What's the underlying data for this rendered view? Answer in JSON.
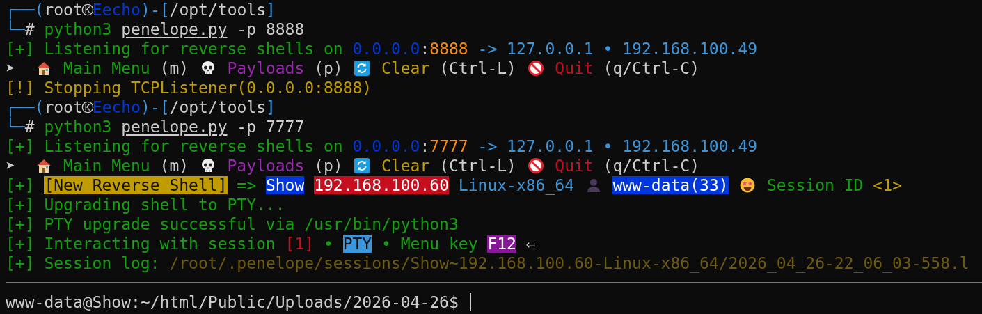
{
  "lines": [
    {
      "segments": [
        {
          "kind": "text",
          "text": "┌──(",
          "color": "#3a96dd"
        },
        {
          "kind": "text",
          "text": "root",
          "color": "#cccccc"
        },
        {
          "kind": "kali"
        },
        {
          "kind": "text",
          "text": "Eecho",
          "color": "#0037da"
        },
        {
          "kind": "text",
          "text": ")-[",
          "color": "#3a96dd"
        },
        {
          "kind": "text",
          "text": "/opt/tools",
          "color": "#cccccc"
        },
        {
          "kind": "text",
          "text": "]",
          "color": "#3a96dd"
        }
      ]
    },
    {
      "segments": [
        {
          "kind": "text",
          "text": "└─",
          "color": "#3a96dd"
        },
        {
          "kind": "text",
          "text": "# ",
          "color": "#cccccc"
        },
        {
          "kind": "text",
          "text": "python3 ",
          "color": "#13a10e"
        },
        {
          "kind": "file",
          "text": "penelope.py",
          "color": "#cccccc"
        },
        {
          "kind": "text",
          "text": " -p 8888",
          "color": "#cccccc"
        }
      ]
    },
    {
      "segments": [
        {
          "kind": "text",
          "text": "[+] Listening for reverse shells on ",
          "color": "#13a10e"
        },
        {
          "kind": "text",
          "text": "0.0.0.0",
          "color": "#0037da"
        },
        {
          "kind": "text",
          "text": ":",
          "color": "#cccccc"
        },
        {
          "kind": "text",
          "text": "8888",
          "color": "#f78c0c"
        },
        {
          "kind": "text",
          "text": " -> 127.0.0.1 • 192.168.100.49",
          "color": "#3a96dd"
        }
      ]
    },
    {
      "segments": [
        {
          "kind": "text",
          "text": "➤  ",
          "color": "#cccccc"
        },
        {
          "kind": "house"
        },
        {
          "kind": "text",
          "text": " Main Menu ",
          "color": "#13a10e"
        },
        {
          "kind": "text",
          "text": "(m) ",
          "color": "#cccccc"
        },
        {
          "kind": "skull"
        },
        {
          "kind": "text",
          "text": " Payloads ",
          "color": "#9a2aae"
        },
        {
          "kind": "text",
          "text": "(p) ",
          "color": "#cccccc"
        },
        {
          "kind": "refresh"
        },
        {
          "kind": "text",
          "text": " Clear ",
          "color": "#c19c00"
        },
        {
          "kind": "text",
          "text": "(Ctrl-L) ",
          "color": "#cccccc"
        },
        {
          "kind": "noentry"
        },
        {
          "kind": "text",
          "text": " Quit ",
          "color": "#c50f1f"
        },
        {
          "kind": "text",
          "text": "(q/Ctrl-C)",
          "color": "#cccccc"
        }
      ]
    },
    {
      "segments": [
        {
          "kind": "text",
          "text": "[!] Stopping TCPListener(0.0.0.0:8888)",
          "color": "#c19c00"
        }
      ]
    },
    {
      "segments": [
        {
          "kind": "text",
          "text": "┌──(",
          "color": "#3a96dd"
        },
        {
          "kind": "text",
          "text": "root",
          "color": "#cccccc"
        },
        {
          "kind": "kali"
        },
        {
          "kind": "text",
          "text": "Eecho",
          "color": "#0037da"
        },
        {
          "kind": "text",
          "text": ")-[",
          "color": "#3a96dd"
        },
        {
          "kind": "text",
          "text": "/opt/tools",
          "color": "#cccccc"
        },
        {
          "kind": "text",
          "text": "]",
          "color": "#3a96dd"
        }
      ]
    },
    {
      "segments": [
        {
          "kind": "text",
          "text": "└─",
          "color": "#3a96dd"
        },
        {
          "kind": "text",
          "text": "# ",
          "color": "#cccccc"
        },
        {
          "kind": "text",
          "text": "python3 ",
          "color": "#13a10e"
        },
        {
          "kind": "file",
          "text": "penelope.py",
          "color": "#cccccc"
        },
        {
          "kind": "text",
          "text": " -p 7777",
          "color": "#cccccc"
        }
      ]
    },
    {
      "segments": [
        {
          "kind": "text",
          "text": "[+] Listening for reverse shells on ",
          "color": "#13a10e"
        },
        {
          "kind": "text",
          "text": "0.0.0.0",
          "color": "#0037da"
        },
        {
          "kind": "text",
          "text": ":",
          "color": "#cccccc"
        },
        {
          "kind": "text",
          "text": "7777",
          "color": "#f78c0c"
        },
        {
          "kind": "text",
          "text": " -> 127.0.0.1 • 192.168.100.49",
          "color": "#3a96dd"
        }
      ]
    },
    {
      "segments": [
        {
          "kind": "text",
          "text": "➤  ",
          "color": "#cccccc"
        },
        {
          "kind": "house"
        },
        {
          "kind": "text",
          "text": " Main Menu ",
          "color": "#13a10e"
        },
        {
          "kind": "text",
          "text": "(m) ",
          "color": "#cccccc"
        },
        {
          "kind": "skull"
        },
        {
          "kind": "text",
          "text": " Payloads ",
          "color": "#9a2aae"
        },
        {
          "kind": "text",
          "text": "(p) ",
          "color": "#cccccc"
        },
        {
          "kind": "refresh"
        },
        {
          "kind": "text",
          "text": " Clear ",
          "color": "#c19c00"
        },
        {
          "kind": "text",
          "text": "(Ctrl-L) ",
          "color": "#cccccc"
        },
        {
          "kind": "noentry"
        },
        {
          "kind": "text",
          "text": " Quit ",
          "color": "#c50f1f"
        },
        {
          "kind": "text",
          "text": "(q/Ctrl-C)",
          "color": "#cccccc"
        }
      ]
    },
    {
      "segments": [
        {
          "kind": "text",
          "text": "[+] ",
          "color": "#13a10e"
        },
        {
          "kind": "badge",
          "text": "[New Reverse Shell]",
          "color": "#c19c00"
        },
        {
          "kind": "text",
          "text": " => ",
          "color": "#13a10e"
        },
        {
          "kind": "badge",
          "text": "Show",
          "color": "#0037da"
        },
        {
          "kind": "gap"
        },
        {
          "kind": "badge",
          "text": "192.168.100.60",
          "color": "#c50f1f"
        },
        {
          "kind": "text",
          "text": " Linux-x86_64 ",
          "color": "#3a96dd"
        },
        {
          "kind": "person"
        },
        {
          "kind": "gap"
        },
        {
          "kind": "badge",
          "text": "www-data(33)",
          "color": "#0037da"
        },
        {
          "kind": "gap"
        },
        {
          "kind": "starstruck"
        },
        {
          "kind": "text",
          "text": " Session ID ",
          "color": "#13a10e"
        },
        {
          "kind": "text",
          "text": "<1>",
          "color": "#c19c00"
        }
      ]
    },
    {
      "segments": [
        {
          "kind": "text",
          "text": "[+] Upgrading shell to PTY...",
          "color": "#13a10e"
        }
      ]
    },
    {
      "segments": [
        {
          "kind": "text",
          "text": "[+] PTY upgrade successful via /usr/bin/python3",
          "color": "#13a10e"
        }
      ]
    },
    {
      "segments": [
        {
          "kind": "text",
          "text": "[+] Interacting with session ",
          "color": "#13a10e"
        },
        {
          "kind": "text",
          "text": "[1]",
          "color": "#c50f1f"
        },
        {
          "kind": "text",
          "text": " • ",
          "color": "#13a10e"
        },
        {
          "kind": "badge",
          "text": "PTY",
          "color": "#3a96dd"
        },
        {
          "kind": "text",
          "text": " • Menu key ",
          "color": "#13a10e"
        },
        {
          "kind": "badge",
          "text": "F12",
          "color": "#881798"
        },
        {
          "kind": "text",
          "text": " ⇐",
          "color": "#cccccc"
        }
      ]
    },
    {
      "segments": [
        {
          "kind": "text",
          "text": "[+] Session log: ",
          "color": "#13a10e"
        },
        {
          "kind": "text",
          "text": "/root/.penelope/sessions/Show~192.168.100.60-Linux-x86_64/2026_04_26-22_06_03-558.l",
          "color": "#6e5a0c"
        }
      ]
    }
  ],
  "prompt": {
    "text": "www-data@Show:~/html/Public/Uploads/2026-04-26$ ",
    "color": "#cccccc"
  }
}
